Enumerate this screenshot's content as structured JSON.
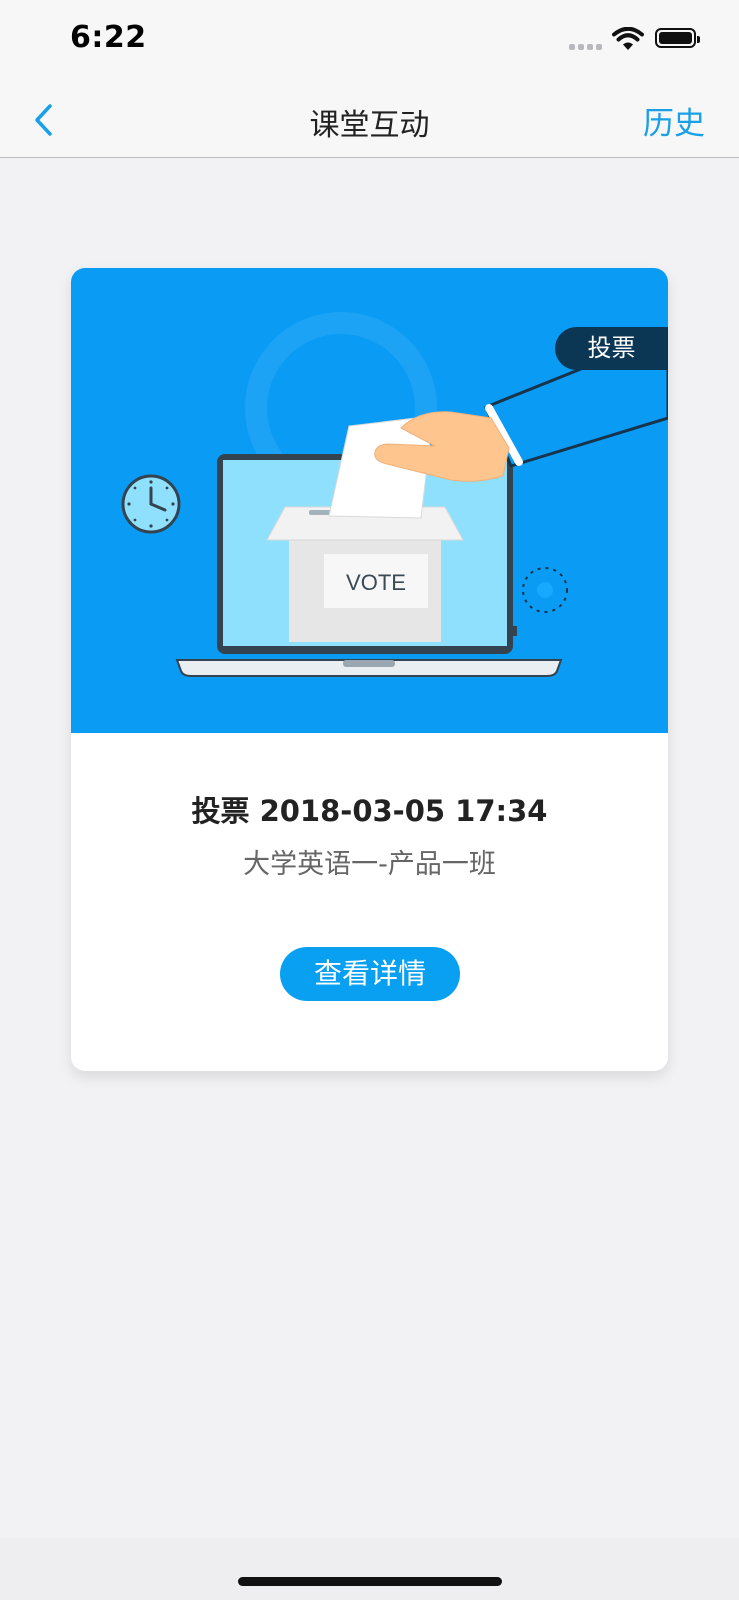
{
  "status_bar": {
    "time": "6:22"
  },
  "nav": {
    "title": "课堂互动",
    "history": "历史"
  },
  "card": {
    "tag": "投票",
    "illustration": {
      "box_label": "VOTE"
    },
    "title": "投票 2018-03-05 17:34",
    "class_name": "大学英语一-产品一班",
    "button": "查看详情"
  },
  "colors": {
    "accent": "#1aa0e6",
    "illustration_bg": "#0a9bf5",
    "tag_bg": "#0b3654"
  }
}
